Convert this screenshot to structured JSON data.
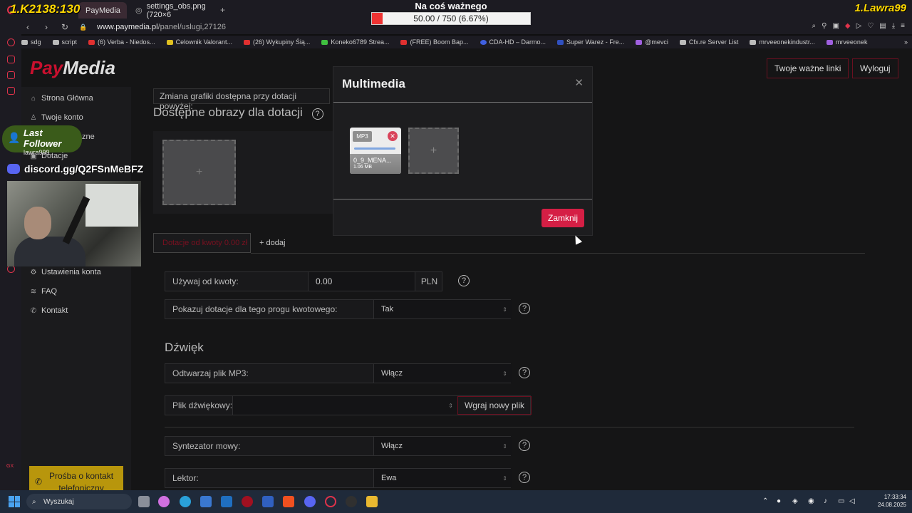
{
  "browser": {
    "tabs": [
      {
        "label": "PayMedia"
      },
      {
        "label": "settings_obs.png (720×6"
      }
    ],
    "url_domain": "www.paymedia.pl",
    "url_path": "/panel/uslugi,27126",
    "bookmarks": [
      {
        "label": "sdg",
        "color": "#bbbbbb"
      },
      {
        "label": "script",
        "color": "#bbbbbb"
      },
      {
        "label": "(6) Verba - Niedos...",
        "color": "#e03030"
      },
      {
        "label": "Celownik Valorant...",
        "color": "#e0c020"
      },
      {
        "label": "(26) Wykupiny Śią...",
        "color": "#e03030"
      },
      {
        "label": "Koneko6789 Strea...",
        "color": "#40c040"
      },
      {
        "label": "(FREE) Boom Bap...",
        "color": "#e03030"
      },
      {
        "label": "CDA-HD – Darmo...",
        "color": "#4060e0"
      },
      {
        "label": "Super Warez - Fre...",
        "color": "#3050c0"
      },
      {
        "label": "@mevci",
        "color": "#a060e0"
      },
      {
        "label": "Cfx.re Server List",
        "color": "#bbbbbb"
      },
      {
        "label": "mrveeonekindustr...",
        "color": "#bbbbbb"
      },
      {
        "label": "mrveeonek",
        "color": "#a060e0"
      }
    ]
  },
  "overlay": {
    "top_left": "1.K2138:130",
    "top_right": "1.Lawra99",
    "goal_title": "Na coś ważnego",
    "goal_text": "50.00 / 750 (6.67%)",
    "goal_progress": 0.0667,
    "follower_title": "Last Follower",
    "follower_name": "lawra999",
    "discord": "discord.gg/Q2FSnMeBFZ"
  },
  "header": {
    "logo_pay": "Pay",
    "logo_media": "Media",
    "links_button": "Twoje ważne linki",
    "logout_button": "Wyloguj"
  },
  "sidebar": {
    "items": [
      {
        "label": "Strona Główna",
        "icon": "home-icon"
      },
      {
        "label": "Twoje konto",
        "icon": "user-icon"
      },
      {
        "label": "Dotacje",
        "icon": "gift-icon"
      },
      {
        "label": "Ustawienia konta",
        "icon": "gear-icon"
      },
      {
        "label": "FAQ",
        "icon": "layers-icon"
      },
      {
        "label": "Kontakt",
        "icon": "phone-icon"
      }
    ],
    "partial_label": "zne",
    "phone_button": "Prośba o kontakt telefoniczny"
  },
  "main": {
    "top_note": "Zmiana grafiki dostępna przy dotacji powyżej:",
    "images_heading": "Dostępne obrazy dla dotacji",
    "image_add": "+",
    "threshold_tab": "Dotacje od kwoty 0.00 zł",
    "add_tab": "+ dodaj",
    "use_from_label": "Używaj od kwoty:",
    "use_from_value": "0.00",
    "currency": "PLN",
    "show_label": "Pokazuj dotacje dla tego progu kwotowego:",
    "show_value": "Tak",
    "sound_heading": "Dźwięk",
    "play_mp3_label": "Odtwarzaj plik MP3:",
    "play_mp3_value": "Włącz",
    "sound_file_label": "Plik dźwiękowy:",
    "upload_button": "Wgraj nowy plik",
    "tts_label": "Syntezator mowy:",
    "tts_value": "Włącz",
    "lector_label": "Lektor:",
    "lector_value": "Ewa"
  },
  "modal": {
    "title": "Multimedia",
    "file_ext": "MP3",
    "file_name": "0_9_MENA...",
    "file_size": "1.06 MB",
    "add": "+",
    "close_button": "Zamknij"
  },
  "taskbar": {
    "search_placeholder": "Wyszukaj",
    "time": "17:33:34",
    "date": "24.08.2025"
  }
}
